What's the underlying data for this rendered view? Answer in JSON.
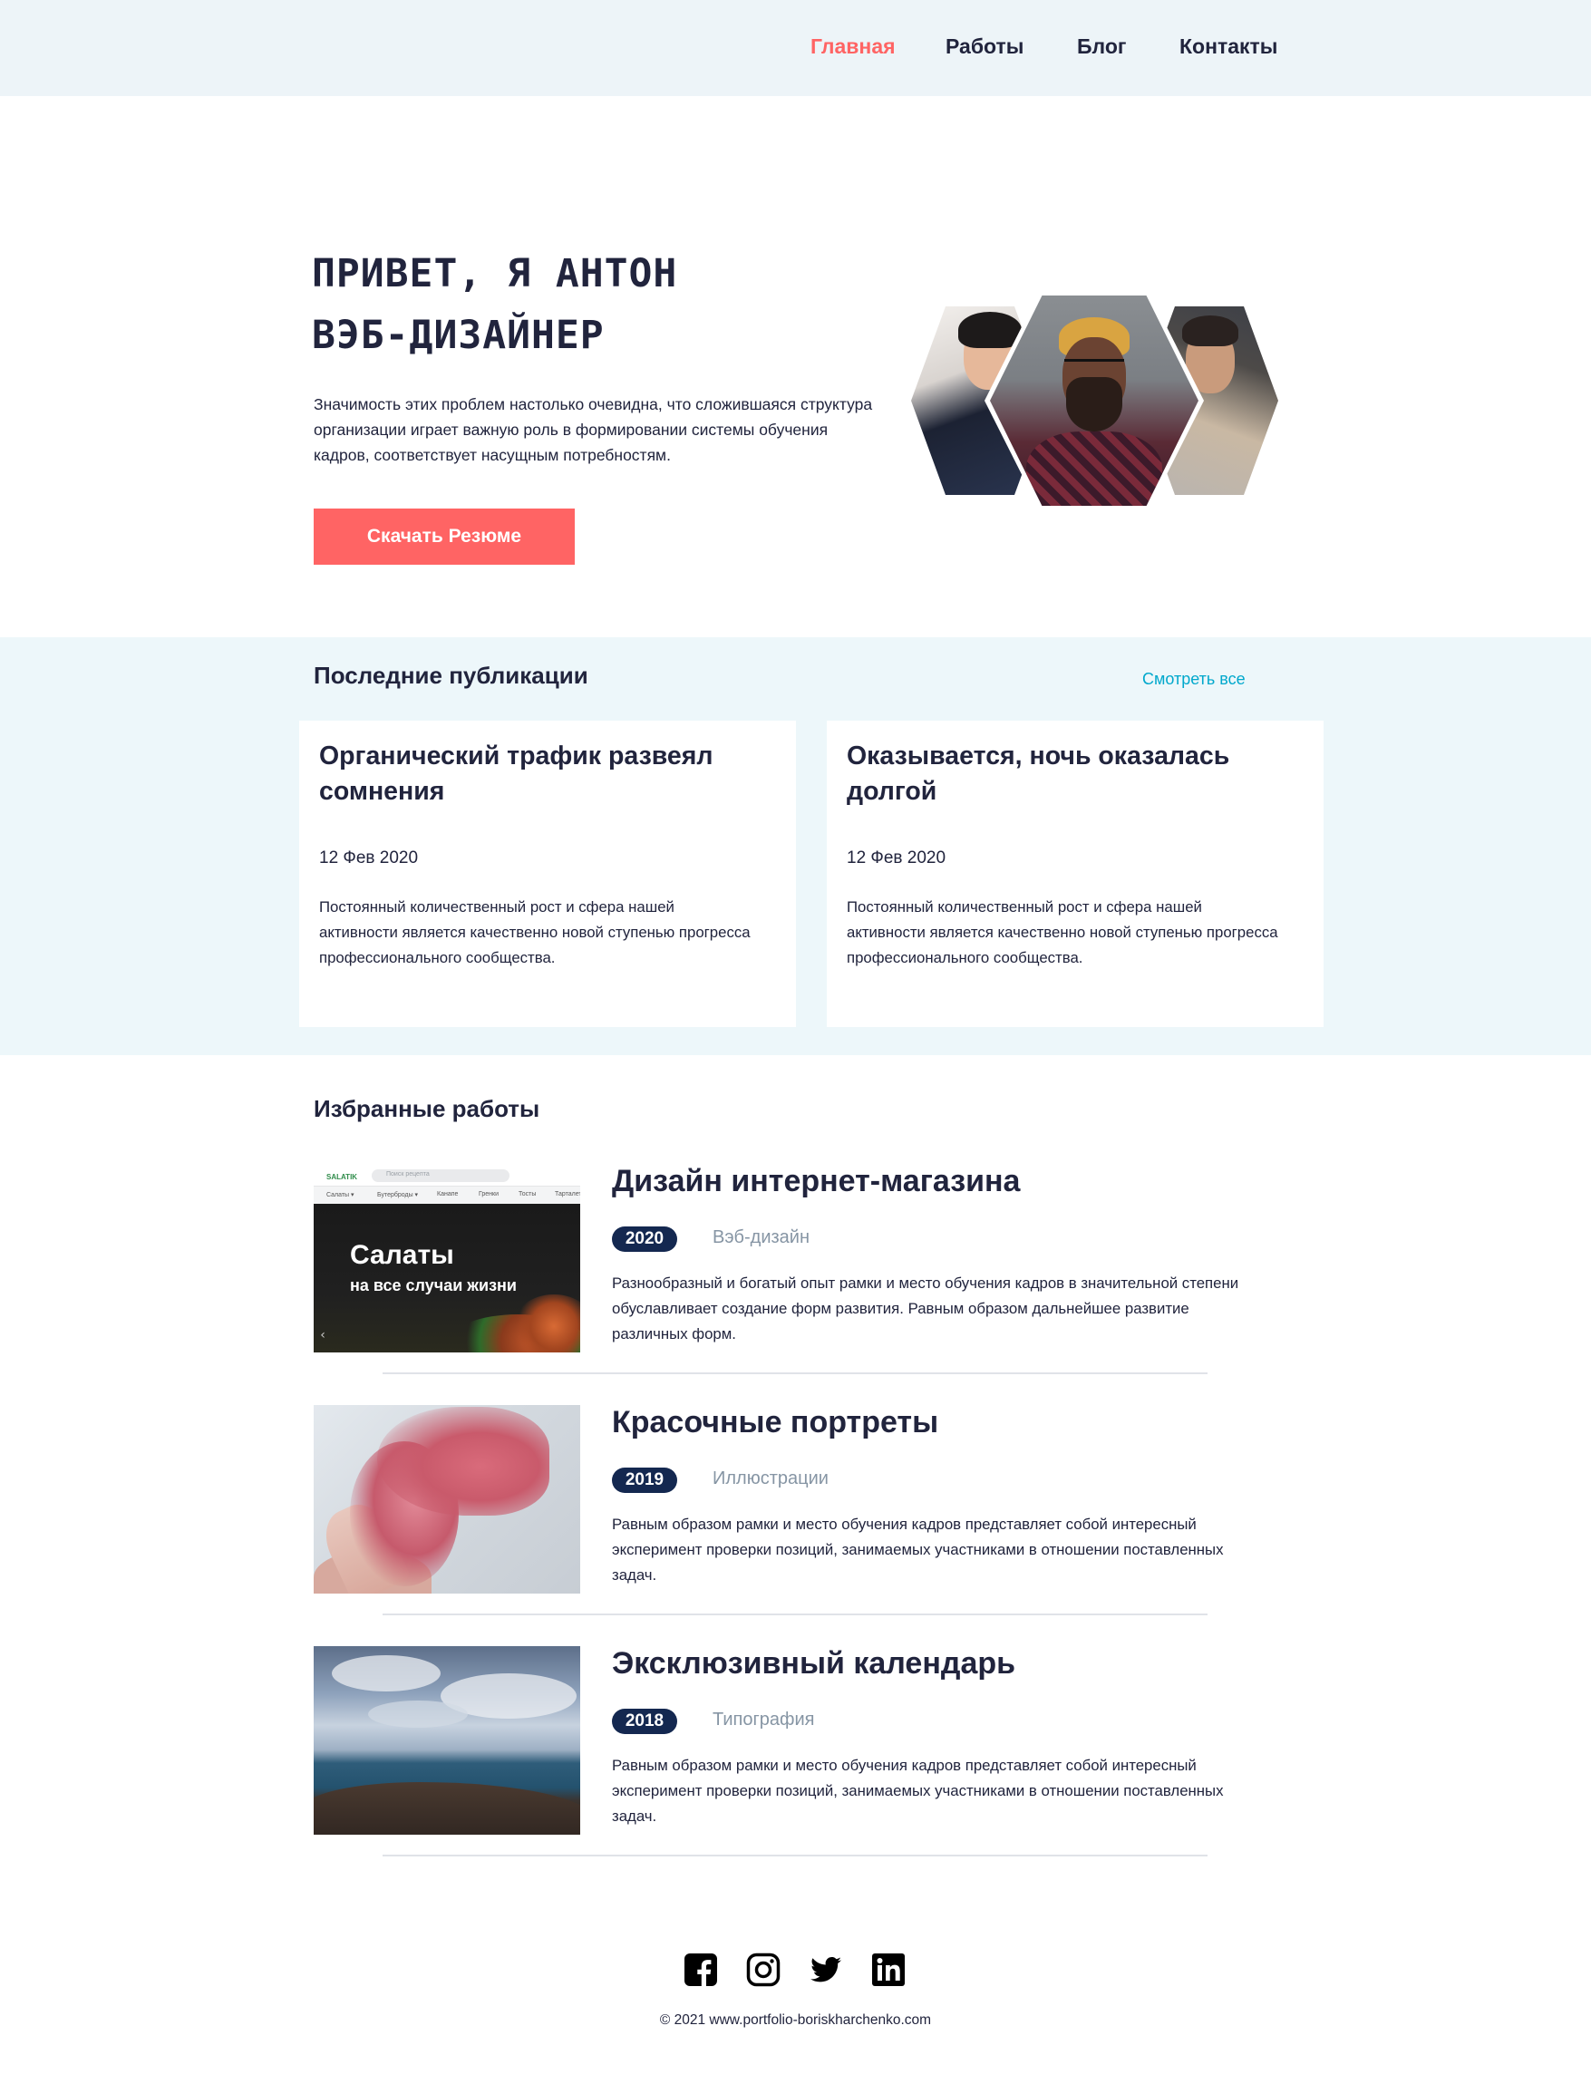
{
  "nav": {
    "items": [
      {
        "label": "Главная",
        "active": true
      },
      {
        "label": "Работы",
        "active": false
      },
      {
        "label": "Блог",
        "active": false
      },
      {
        "label": "Контакты",
        "active": false
      }
    ]
  },
  "hero": {
    "title_line1": "ПРИВЕТ, Я АНТОН",
    "title_line2": "ВЭБ-ДИЗАЙНЕР",
    "text": "Значимость этих проблем настолько очевидна, что сложившаяся структура организации играет важную роль в формировании системы обучения кадров, соответствует насущным потребностям.",
    "button": "Скачать Резюме"
  },
  "publications": {
    "title": "Последние публикации",
    "see_all": "Смотреть все",
    "posts": [
      {
        "title": "Органический трафик развеял сомнения",
        "date": "12 Фев 2020",
        "text": "Постоянный количественный рост и сфера нашей активности является качественно новой ступенью прогресса профессионального сообщества."
      },
      {
        "title": "Оказывается, ночь оказалась долгой",
        "date": "12 Фев 2020",
        "text": "Постоянный количественный рост и сфера нашей активности является качественно новой ступенью прогресса профессионального сообщества."
      }
    ]
  },
  "works": {
    "title": "Избранные работы",
    "items": [
      {
        "name": "Дизайн интернет-магазина",
        "year": "2020",
        "category": "Вэб-дизайн",
        "text": "Разнообразный и богатый опыт рамки и место обучения кадров в значительной степени обуславливает создание форм развития. Равным образом дальнейшее развитие различных форм.",
        "preview": {
          "heading": "Салаты",
          "subheading": "на все случаи жизни"
        }
      },
      {
        "name": "Красочные портреты",
        "year": "2019",
        "category": "Иллюстрации",
        "text": "Равным образом рамки и место обучения кадров представляет собой интересный эксперимент проверки позиций, занимаемых участниками в отношении поставленных задач."
      },
      {
        "name": "Эксклюзивный календарь",
        "year": "2018",
        "category": "Типография",
        "text": "Равным образом рамки и место обучения кадров представляет собой интересный эксперимент проверки позиций, занимаемых участниками в отношении поставленных задач."
      }
    ]
  },
  "footer": {
    "socials": [
      "facebook-icon",
      "instagram-icon",
      "twitter-icon",
      "linkedin-icon"
    ],
    "copyright": "© 2021 www.portfolio-boriskharchenko.com"
  },
  "colors": {
    "accent": "#ff6464",
    "header_bg": "#edf4f8",
    "section_bg": "#edf7fa",
    "dark": "#21243d",
    "badge": "#142850",
    "link": "#00a8cc",
    "muted": "#8695a4"
  }
}
